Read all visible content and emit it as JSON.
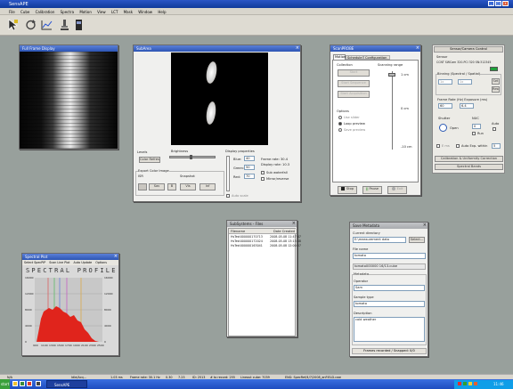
{
  "app": {
    "title": "SensAPE",
    "window_buttons": [
      "_",
      "□",
      "x"
    ]
  },
  "menu": [
    "File",
    "Cube",
    "Calibration",
    "Spectra",
    "Motion",
    "View",
    "LCT",
    "Mask",
    "Window",
    "Help"
  ],
  "toolbar": {
    "icons": [
      "cursor-icon",
      "refresh-icon",
      "chart-icon",
      "microscope-icon",
      "camera-icon"
    ]
  },
  "fullframe": {
    "title": "Full Frame Display"
  },
  "subarea": {
    "title": "SubArea",
    "levels": "Levels",
    "brightness": "Brightness",
    "color_refresh": "Color Refresh",
    "export": "Export Color Image",
    "export_sub": "ISR",
    "snapshot": "Snapshot",
    "small_btns": [
      "Sav",
      "B",
      "Vis",
      "Inf"
    ],
    "display_props": "Display properties",
    "blue_lbl": "Blue:",
    "blue_val": "40",
    "green_lbl": "Green:",
    "green_val": "50",
    "red_lbl": "Red:",
    "red_val": "70",
    "frame_rate": "Frame rate: 30.4",
    "display_rate": "Display rate: 10.3",
    "chk_waterfall": "Sub waterfall",
    "chk_mirror": "Mirror/reverse",
    "chk_bottom": "Auto scale"
  },
  "scan": {
    "title": "ScanPROBE",
    "tabs": [
      "Motion",
      "Schedule",
      "Configuration"
    ],
    "collection": "Collection",
    "scan_btns": [
      "Start",
      "Start Sequence",
      "Start Acquisition"
    ],
    "scanning_range": "Scanning range",
    "scale": [
      "1 cm",
      "0 cm",
      "-10 cm"
    ],
    "options": "Options",
    "opt1": "Use slider",
    "opt2": "Loop preview",
    "opt3": "Save preview",
    "stop": "Stop",
    "pause": "Pause",
    "exit": "Exit"
  },
  "files": {
    "title": "SubSystems - Files",
    "col_name": "Filename",
    "col_date": "Date Created",
    "rows": [
      {
        "name": "HsTest000000170713",
        "date": "2008-05-08 11:47:47"
      },
      {
        "name": "HsTest000000172024",
        "date": "2008-05-08 13:15:48"
      },
      {
        "name": "HsTest000000163041",
        "date": "2008-05-08 12:00:57"
      }
    ]
  },
  "meta": {
    "title": "Save Metadata",
    "current_dir_lbl": "Current directory",
    "current_dir": "E:\\measurement data",
    "select_btn": "Select...",
    "file_name_lbl": "File name",
    "file_name": "tomato",
    "filename_full": "tomato000000 16/13.cube",
    "metadata": "Metadata",
    "operator_lbl": "Operator",
    "operator": "Sam",
    "sample_lbl": "Sample type",
    "sample": "tomato",
    "desc_lbl": "Description",
    "desc": "cold weather",
    "footer": "Frames recorded / Snapped:  0/0"
  },
  "spectral": {
    "title": "Spectral Plot",
    "menu": [
      "Select SpecPIP",
      "Scan Line Plot",
      "Auto Update",
      "Options"
    ],
    "label": "SPECTRAL PROFILE",
    "yticks": [
      "16000",
      "12000",
      "8000",
      "4000",
      "0"
    ],
    "xticks": [
      "900",
      "1100",
      "1300",
      "1500",
      "1700",
      "1900",
      "2100",
      "2300",
      "2500"
    ]
  },
  "rightpanel": {
    "title": "Sensor/Camera Control",
    "sensor_lbl": "Sensor",
    "sensor_name": "CCNT SWCam 320-PCI 320 SN:312345",
    "status_color": "#1fa23a",
    "binning_lbl": "Binning (Spectral / Spatial)",
    "bin_vals": [
      "1x",
      "1x"
    ],
    "set_btn": "Set",
    "reset_btn": "Reset",
    "fps_lbl": "Frame Rate (Hz)  Exposure (ms)",
    "fps_val": "60",
    "exp_val": "6.4",
    "shutter_lbl": "Shutter",
    "nuc_lbl": "NUC",
    "auto_lbl": "Auto",
    "open_lbl": "Open",
    "nuc_val": "0",
    "run_lbl": "Run",
    "ext_lbl": "E ms",
    "autoexp_lbl": "Auto Exp. within",
    "autoexp_val": "5",
    "calib_btn": "Calibration & Uniformity Correction",
    "spectral_btn": "Spectral Bands"
  },
  "status": {
    "s1": "N/A",
    "s2": "Idle/Acq...",
    "s3": "1.03 ms",
    "s4": "Frame rate: 30.1 Hz",
    "s5": "0.30",
    "s6": "7.23",
    "s7": "ID: 2513",
    "s8": "# to record: 255",
    "s9": "Lineout cube: 7039",
    "s10": "ENG: SpecRef/4/7/2008_anFIELD.cwe"
  },
  "taskbar": {
    "start": "start",
    "app_btn": "SensAPE",
    "clock": "11:46"
  }
}
